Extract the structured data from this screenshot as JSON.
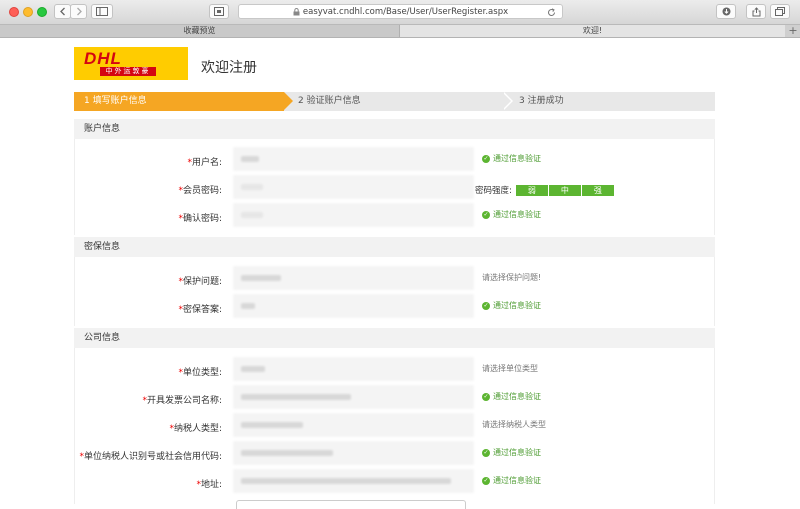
{
  "browser": {
    "url": "easyvat.cndhl.com/Base/User/UserRegister.aspx",
    "tabs": [
      {
        "label": "收藏预览",
        "active": false
      },
      {
        "label": "欢迎!",
        "active": true
      }
    ],
    "new_tab_label": "+"
  },
  "header": {
    "logo_text": "DHL",
    "logo_subtext": "中外运敦豪",
    "welcome": "欢迎注册"
  },
  "steps": [
    {
      "label": "1 填写账户信息",
      "active": true
    },
    {
      "label": "2 验证账户信息",
      "active": false
    },
    {
      "label": "3 注册成功",
      "active": false
    }
  ],
  "sections": {
    "account": {
      "title": "账户信息",
      "fields": [
        {
          "required": "*",
          "label": "用户名:",
          "msg": "通过信息验证",
          "status": "ok"
        },
        {
          "required": "*",
          "label": "会员密码:",
          "strength_label": "密码强度:",
          "strength": [
            "弱",
            "中",
            "强"
          ]
        },
        {
          "required": "*",
          "label": "确认密码:",
          "msg": "通过信息验证",
          "status": "ok"
        }
      ]
    },
    "security": {
      "title": "密保信息",
      "fields": [
        {
          "required": "*",
          "label": "保护问题:",
          "msg": "请选择保护问题!",
          "status": "hint"
        },
        {
          "required": "*",
          "label": "密保答案:",
          "msg": "通过信息验证",
          "status": "ok"
        }
      ]
    },
    "company": {
      "title": "公司信息",
      "fields": [
        {
          "required": "*",
          "label": "单位类型:",
          "msg": "请选择单位类型",
          "status": "hint"
        },
        {
          "required": "*",
          "label": "开具发票公司名称:",
          "msg": "通过信息验证",
          "status": "ok"
        },
        {
          "required": "*",
          "label": "纳税人类型:",
          "msg": "请选择纳税人类型",
          "status": "hint"
        },
        {
          "required": "*",
          "label": "单位纳税人识别号或社会信用代码:",
          "msg": "通过信息验证",
          "status": "ok"
        },
        {
          "required": "*",
          "label": "地址:",
          "msg": "通过信息验证",
          "status": "ok"
        }
      ]
    }
  },
  "colors": {
    "accent": "#f5a623",
    "ok": "#5cb531",
    "required": "#e00000",
    "dhl_yellow": "#ffcc00",
    "dhl_red": "#d40511"
  }
}
